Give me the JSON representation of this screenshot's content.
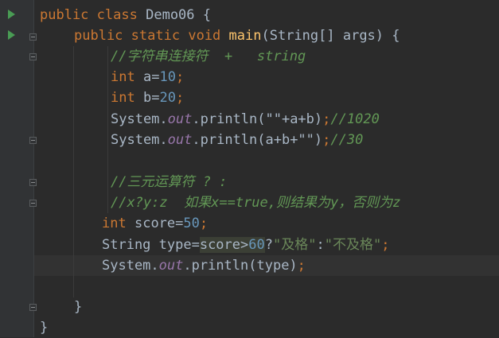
{
  "code": {
    "line1": {
      "kw_public": "public",
      "kw_class": "class",
      "class_name": "Demo06",
      "brace": "{"
    },
    "line2": {
      "kw_public": "public",
      "kw_static": "static",
      "kw_void": "void",
      "method": "main",
      "params": "(String[] args)",
      "brace": "{"
    },
    "line3": {
      "comment": "//字符串连接符  +   string"
    },
    "line4": {
      "kw_int": "int",
      "decl": "a=",
      "num": "10",
      "semi": ";"
    },
    "line5": {
      "kw_int": "int",
      "decl": "b=",
      "num": "20",
      "semi": ";"
    },
    "line6": {
      "sys": "System.",
      "out": "out",
      "call": ".println(\"\"+a+b)",
      "semi": ";",
      "comment": "//1020"
    },
    "line7": {
      "sys": "System.",
      "out": "out",
      "call": ".println(a+b+\"\")",
      "semi": ";",
      "comment": "//30"
    },
    "line8": {
      "comment": "//三元运算符 ? :"
    },
    "line9": {
      "comment": "//x?y:z  如果x==true,则结果为y，否则为z"
    },
    "line10": {
      "kw_int": "int",
      "decl": "score=",
      "num": "50",
      "semi": ";"
    },
    "line11": {
      "pre": "String type=",
      "hl_text": "score>",
      "hl_num": "60",
      "q": "?",
      "str1": "\"及格\"",
      "colon": ":",
      "str2": "\"不及格\"",
      "semi": ";"
    },
    "line12": {
      "sys": "System.",
      "out": "out",
      "call": ".println(type)",
      "semi": ";"
    },
    "line13": {
      "brace": "}"
    },
    "line14": {
      "brace": "}"
    }
  },
  "colors": {
    "background": "#2b2b2b",
    "keyword": "#cc7832",
    "method": "#ffc66d",
    "number": "#6897bb",
    "string": "#6a8759",
    "comment": "#629755",
    "field": "#9876aa",
    "text": "#a9b7c6",
    "run_icon": "#499c54"
  },
  "icons": [
    "run-icon",
    "fold-icon"
  ]
}
